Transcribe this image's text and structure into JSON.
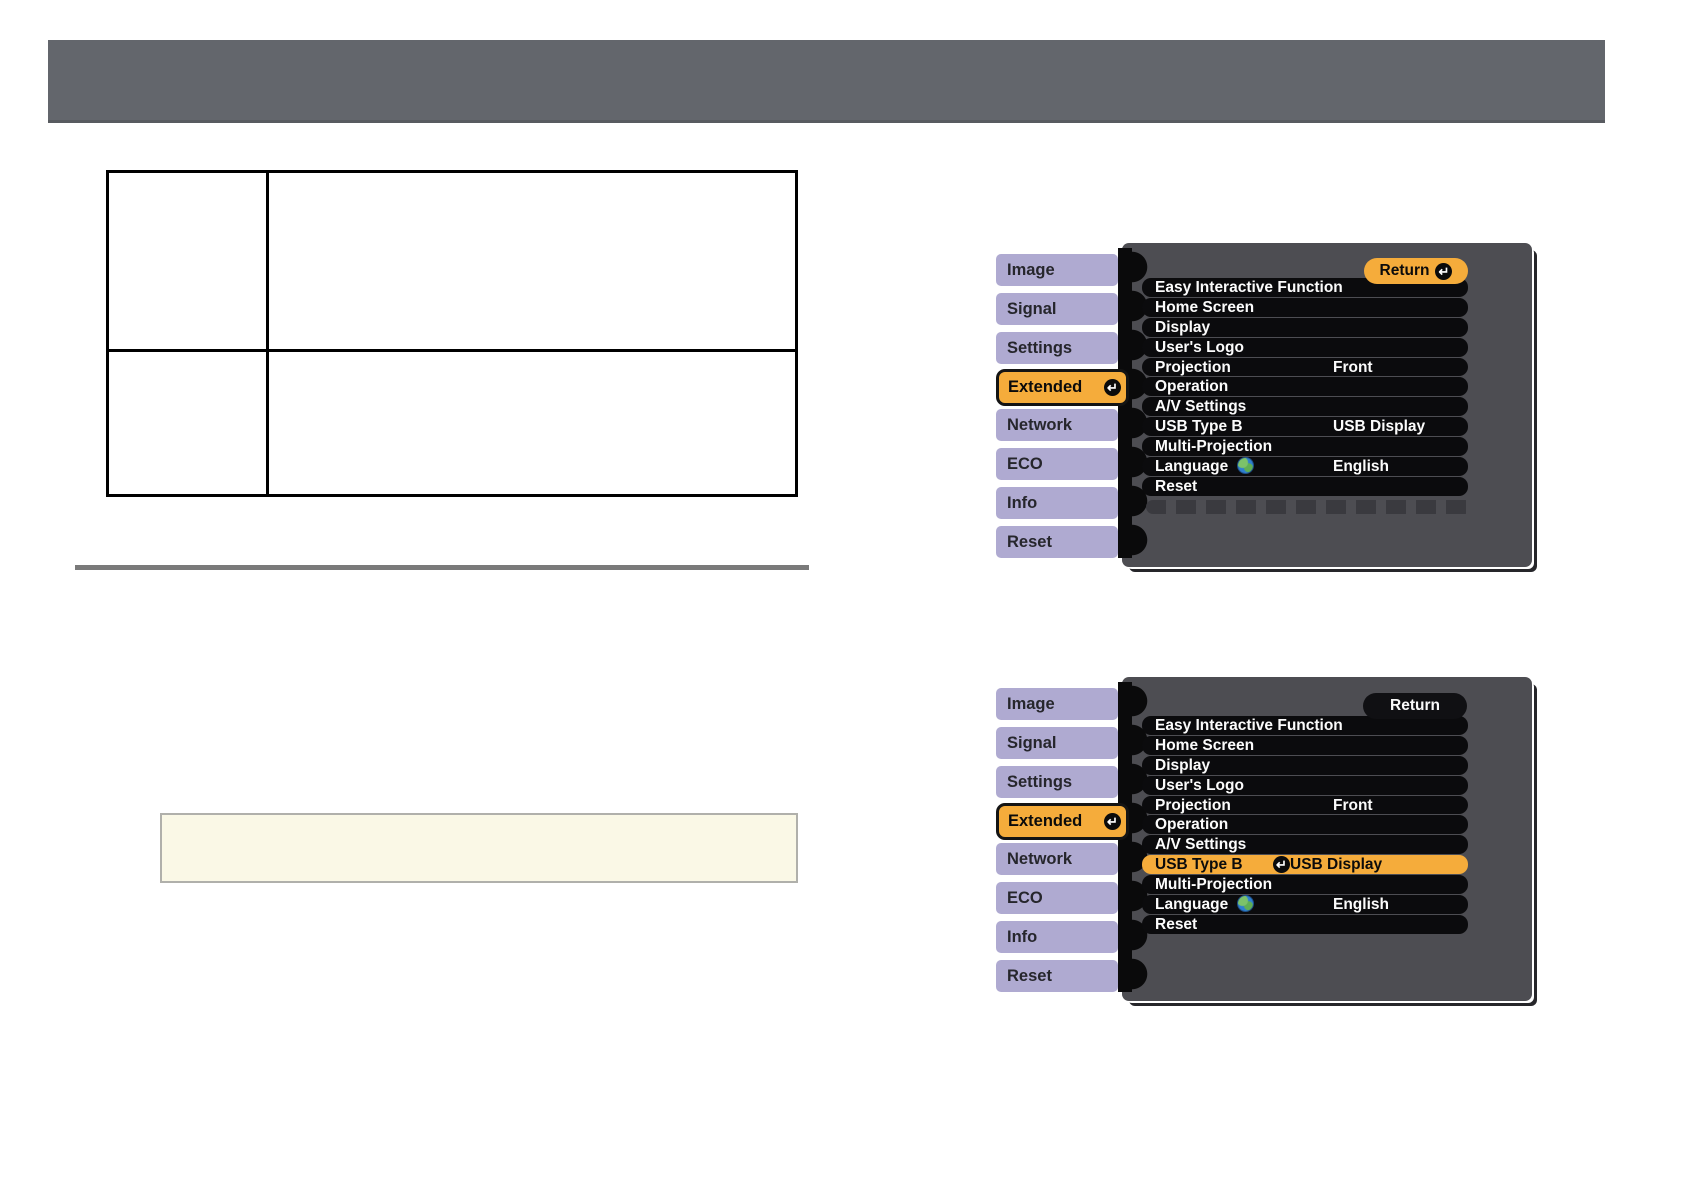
{
  "colors": {
    "header_bar": "#63666C",
    "osd_panel": "#4D4D52",
    "osd_tab": "#AFAAD1",
    "accent_orange": "#F5AC3B",
    "note_bg": "#FAF8E6",
    "note_border": "#B0B0AB",
    "divider_rule": "#7A7A7A"
  },
  "table": {
    "rows": [
      [
        "",
        ""
      ],
      [
        "",
        ""
      ]
    ]
  },
  "note": {
    "text": ""
  },
  "menus": [
    {
      "return_label": "Return",
      "return_style": "orange",
      "tabs": [
        "Image",
        "Signal",
        "Settings",
        "Extended",
        "Network",
        "ECO",
        "Info",
        "Reset"
      ],
      "active_tab": "Extended",
      "items": [
        {
          "label": "Easy Interactive Function"
        },
        {
          "label": "Home Screen"
        },
        {
          "label": "Display"
        },
        {
          "label": "User's Logo"
        },
        {
          "label": "Projection",
          "value": "Front"
        },
        {
          "label": "Operation"
        },
        {
          "label": "A/V Settings"
        },
        {
          "label": "USB Type B",
          "value": "USB Display"
        },
        {
          "label": "Multi-Projection"
        },
        {
          "label": "Language",
          "value": "English",
          "icon": "globe"
        },
        {
          "label": "Reset"
        }
      ],
      "has_scroll_texture": true
    },
    {
      "return_label": "Return",
      "return_style": "dark",
      "tabs": [
        "Image",
        "Signal",
        "Settings",
        "Extended",
        "Network",
        "ECO",
        "Info",
        "Reset"
      ],
      "active_tab": "Extended",
      "highlighted_item": "USB Type B",
      "items": [
        {
          "label": "Easy Interactive Function"
        },
        {
          "label": "Home Screen"
        },
        {
          "label": "Display"
        },
        {
          "label": "User's Logo"
        },
        {
          "label": "Projection",
          "value": "Front"
        },
        {
          "label": "Operation"
        },
        {
          "label": "A/V Settings"
        },
        {
          "label": "USB Type B",
          "value": "USB Display",
          "icon": "return"
        },
        {
          "label": "Multi-Projection"
        },
        {
          "label": "Language",
          "value": "English",
          "icon": "globe"
        },
        {
          "label": "Reset"
        }
      ],
      "has_scroll_texture": false
    }
  ]
}
